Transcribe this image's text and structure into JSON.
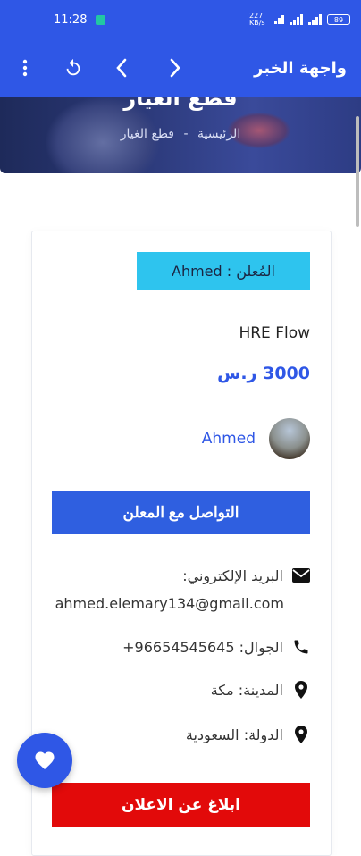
{
  "status_bar": {
    "time": "11:28",
    "network": "227 KB/s",
    "battery": "89"
  },
  "app_bar": {
    "title": "واجهة الخبر"
  },
  "hero": {
    "title": "قطع الغيار",
    "breadcrumb_home": "الرئيسية",
    "breadcrumb_sep": "-",
    "breadcrumb_current": "قطع الغيار"
  },
  "listing": {
    "advertiser_badge": "المُعلن : Ahmed",
    "product_name": "HRE Flow",
    "price": "3000 ر.س",
    "seller_name": "Ahmed",
    "contact_button": "التواصل مع المعلن",
    "email_label": "البريد الإلكتروني:",
    "email_value": "ahmed.elemary134@gmail.com",
    "phone": "الجوال: 96654545645+",
    "city": "المدينة: مكة",
    "country": "الدولة: السعودية",
    "report_button": "ابلاغ عن الاعلان"
  },
  "colors": {
    "primary": "#2f57e6",
    "badge": "#2ec4ee",
    "danger": "#e20a0a"
  },
  "icons": {
    "menu": "more-vert-icon",
    "refresh": "refresh-icon",
    "back": "chevron-left-icon",
    "forward": "chevron-right-icon",
    "email": "mail-icon",
    "phone": "phone-icon",
    "location": "location-pin-icon",
    "favorite": "heart-icon"
  }
}
